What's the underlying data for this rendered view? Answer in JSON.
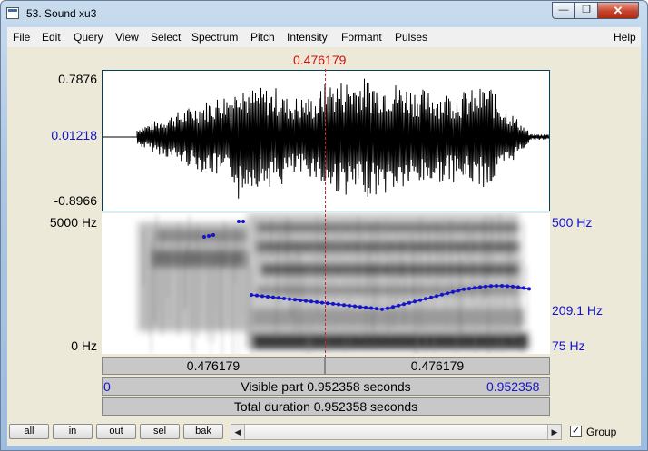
{
  "window": {
    "title": "53. Sound xu3",
    "min_glyph": "—",
    "max_glyph": "❐",
    "close_glyph": "✕"
  },
  "menu": [
    "File",
    "Edit",
    "Query",
    "View",
    "Select",
    "Spectrum",
    "Pitch",
    "Intensity",
    "Formant",
    "Pulses"
  ],
  "help": "Help",
  "cursor_time": "0.476179",
  "waveform": {
    "max": "0.7876",
    "zero": "0.01218",
    "min": "-0.8966"
  },
  "spectrogram": {
    "top": "5000 Hz",
    "bottom": "0 Hz"
  },
  "pitch": {
    "top": "500 Hz",
    "mid": "209.1 Hz",
    "bottom": "75 Hz"
  },
  "segment": {
    "left": "0.476179",
    "right": "0.476179"
  },
  "visible": {
    "start": "0",
    "label": "Visible part 0.952358 seconds",
    "end": "0.952358"
  },
  "total": "Total duration 0.952358 seconds",
  "buttons": {
    "all": "all",
    "in": "in",
    "out": "out",
    "sel": "sel",
    "bak": "bak"
  },
  "scroll": {
    "left_arrow": "◀",
    "right_arrow": "▶"
  },
  "group": {
    "label": "Group",
    "checked": "✓"
  },
  "colors": {
    "cursor": "#d01010",
    "pitch": "#1414c8",
    "waveform": "#000000"
  }
}
